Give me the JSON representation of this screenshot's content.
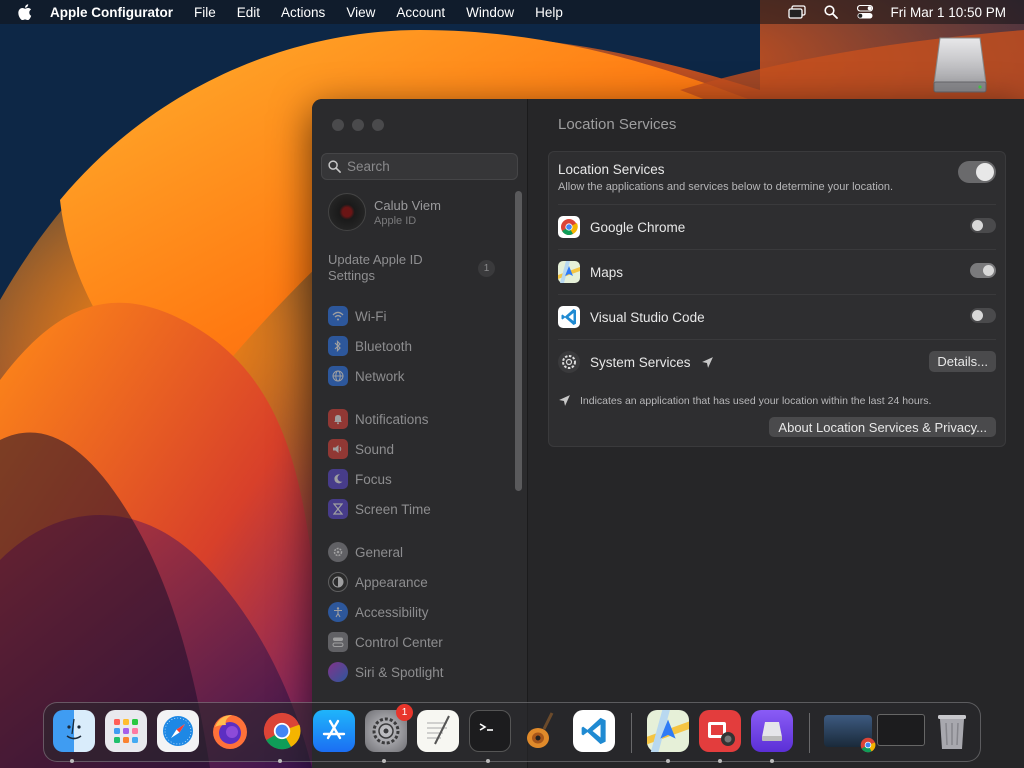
{
  "menubar": {
    "app_name": "Apple Configurator",
    "items": [
      "File",
      "Edit",
      "Actions",
      "View",
      "Account",
      "Window",
      "Help"
    ],
    "clock": "Fri Mar 1  10:50 PM"
  },
  "sidebar": {
    "search_placeholder": "Search",
    "profile": {
      "name": "Calub Viem",
      "subtitle": "Apple ID"
    },
    "update": {
      "label": "Update Apple ID Settings",
      "badge": "1"
    },
    "items": [
      {
        "label": "Wi-Fi",
        "icon": "wifi-icon",
        "color": "#2f7bf6"
      },
      {
        "label": "Bluetooth",
        "icon": "bluetooth-icon",
        "color": "#2f7bf6"
      },
      {
        "label": "Network",
        "icon": "globe-icon",
        "color": "#2f7bf6"
      },
      {
        "label": "Notifications",
        "icon": "bell-icon",
        "color": "#e5443a"
      },
      {
        "label": "Sound",
        "icon": "speaker-icon",
        "color": "#e5443a"
      },
      {
        "label": "Focus",
        "icon": "moon-icon",
        "color": "#5e4bd6"
      },
      {
        "label": "Screen Time",
        "icon": "hourglass-icon",
        "color": "#5e4bd6"
      },
      {
        "label": "General",
        "icon": "gear-icon",
        "color": "#8e8e93"
      },
      {
        "label": "Appearance",
        "icon": "appearance-icon",
        "color": "#2b2b2b"
      },
      {
        "label": "Accessibility",
        "icon": "accessibility-icon",
        "color": "#2f7bf6"
      },
      {
        "label": "Control Center",
        "icon": "control-center-icon",
        "color": "#8e8e93"
      },
      {
        "label": "Siri & Spotlight",
        "icon": "siri-icon",
        "color": "#c93ad6"
      }
    ]
  },
  "content": {
    "title": "Location Services",
    "location_services": {
      "title": "Location Services",
      "description": "Allow the applications and services below to determine your location.",
      "enabled": true
    },
    "apps": [
      {
        "label": "Google Chrome",
        "icon": "chrome-icon",
        "enabled": false
      },
      {
        "label": "Maps",
        "icon": "maps-icon",
        "enabled": true
      },
      {
        "label": "Visual Studio Code",
        "icon": "vscode-icon",
        "enabled": false
      }
    ],
    "system_services": {
      "label": "System Services",
      "button": "Details..."
    },
    "footnote": "Indicates an application that has used your location within the last 24 hours.",
    "about_button": "About Location Services & Privacy..."
  },
  "dock": {
    "items": [
      "finder-icon",
      "launchpad-icon",
      "safari-icon",
      "firefox-icon",
      "chrome-icon",
      "app-store-icon",
      "system-settings-icon",
      "textedit-icon",
      "terminal-icon",
      "garageband-icon",
      "vscode-icon",
      "maps-icon",
      "photo-booth-icon",
      "apple-configurator-icon",
      "preview-window-icon",
      "window-thumbnail-icon",
      "trash-icon"
    ],
    "settings_badge": "1"
  }
}
